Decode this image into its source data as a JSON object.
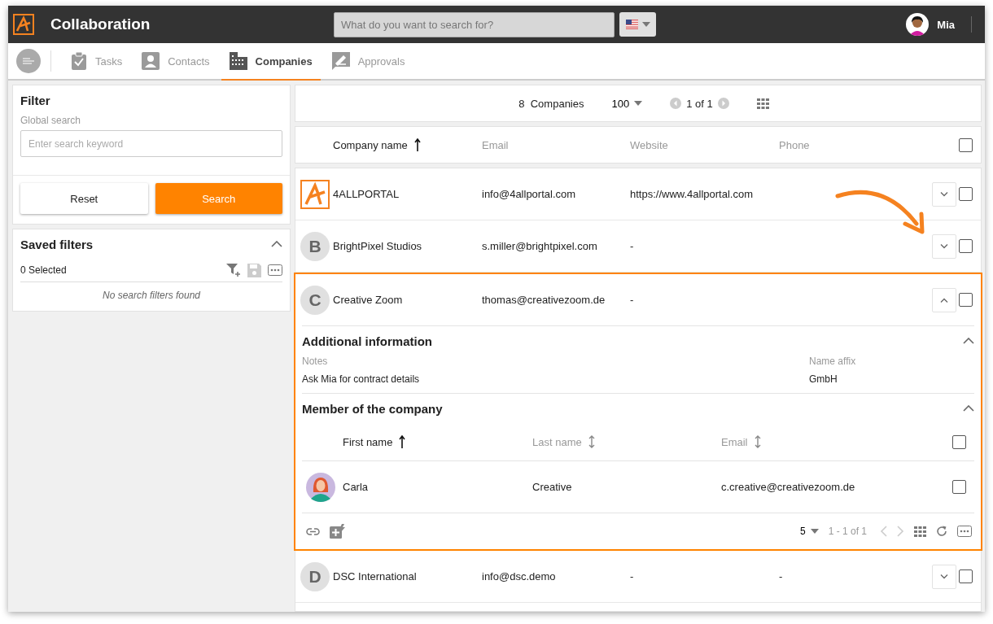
{
  "app": {
    "title": "Collaboration"
  },
  "header": {
    "search_placeholder": "What do you want to search for?",
    "user": "Mia"
  },
  "tabs": [
    {
      "label": "Tasks",
      "kind": "tasks",
      "selected": false
    },
    {
      "label": "Contacts",
      "kind": "contacts",
      "selected": false
    },
    {
      "label": "Companies",
      "kind": "companies",
      "selected": true
    },
    {
      "label": "Approvals",
      "kind": "approvals",
      "selected": false
    }
  ],
  "filter": {
    "title": "Filter",
    "field_label": "Global search",
    "placeholder": "Enter search keyword",
    "reset": "Reset",
    "search": "Search"
  },
  "saved_filters": {
    "title": "Saved filters",
    "expanded": true,
    "selected_count": "0 Selected",
    "empty_text": "No search filters found"
  },
  "toolbar": {
    "count": "8",
    "label": "Companies",
    "page_size": "100",
    "page": "1 of 1"
  },
  "table": {
    "columns": [
      {
        "label": "Company name",
        "sorted": true
      },
      {
        "label": "Email",
        "sorted": false
      },
      {
        "label": "Website",
        "sorted": false
      },
      {
        "label": "Phone",
        "sorted": false
      }
    ],
    "all_checked": false,
    "rows": [
      {
        "kind": "logo",
        "name": "4ALLPORTAL",
        "email": "info@4allportal.com",
        "website": "https://www.4allportal.com",
        "expanded": false,
        "checked": false
      },
      {
        "kind": "letter",
        "initial": "B",
        "name": "BrightPixel Studios",
        "email": "s.miller@brightpixel.com",
        "website": "-",
        "expanded": false,
        "checked": false
      },
      {
        "kind": "letter",
        "initial": "C",
        "name": "Creative Zoom",
        "email": "thomas@creativezoom.de",
        "website": "-",
        "expanded": true,
        "checked": false,
        "details": {
          "info_title": "Additional information",
          "info_expanded": true,
          "fields": [
            {
              "label": "Notes",
              "value": "Ask Mia for contract details"
            },
            {
              "label": "Name affix",
              "value": "GmbH"
            }
          ],
          "members_title": "Member of the company",
          "members_expanded": true,
          "member_columns": [
            {
              "label": "First name",
              "sorted": true
            },
            {
              "label": "Last name",
              "sorted": false
            },
            {
              "label": "Email",
              "sorted": false
            }
          ],
          "members_all_checked": false,
          "members": [
            {
              "first_name": "Carla",
              "last_name": "Creative",
              "email": "c.creative@creativezoom.de",
              "checked": false
            }
          ],
          "page_size": "5",
          "range": "1 - 1 of 1"
        }
      },
      {
        "kind": "letter",
        "initial": "D",
        "name": "DSC International",
        "email": "info@dsc.demo",
        "website": "-",
        "phone": "-",
        "expanded": false,
        "checked": false
      }
    ]
  }
}
